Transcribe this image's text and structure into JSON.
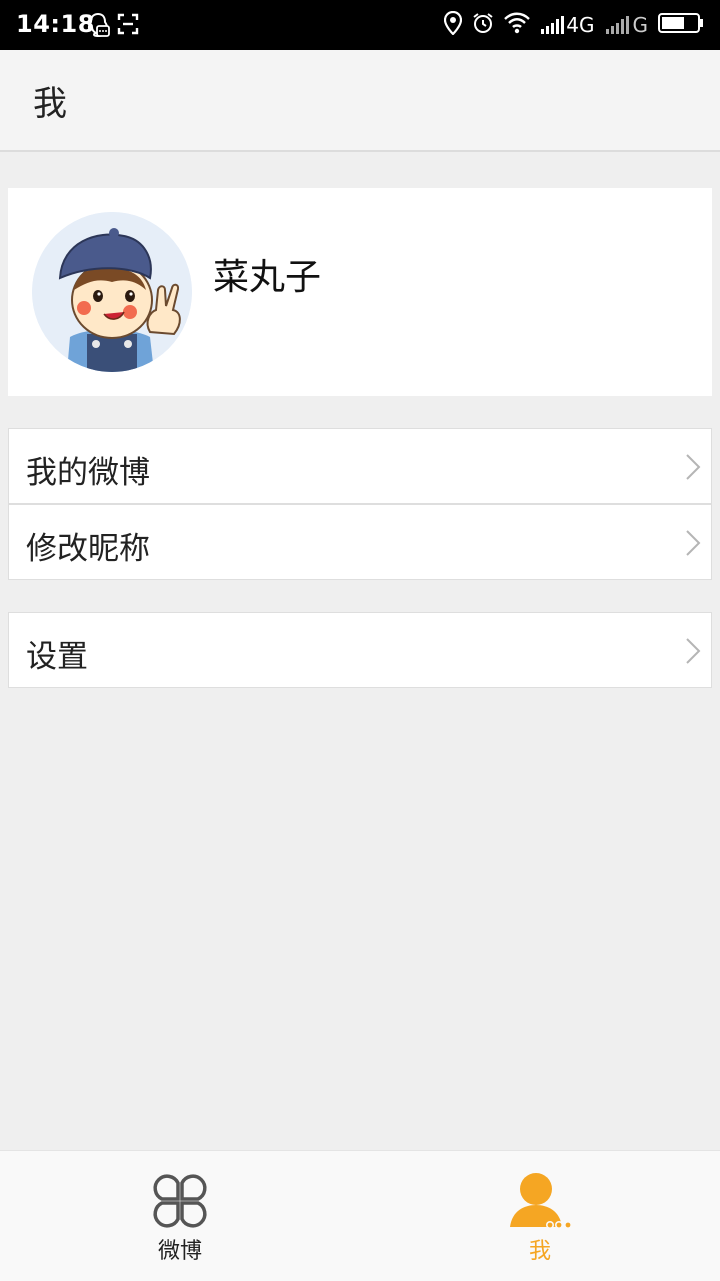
{
  "status_bar": {
    "time": "14:18",
    "network_1": "4G",
    "network_2": "G",
    "icons": [
      "qq-icon",
      "screenshot-icon",
      "location-icon",
      "alarm-icon",
      "wifi-icon",
      "signal-icon",
      "battery-icon"
    ]
  },
  "header": {
    "title": "我"
  },
  "profile": {
    "username": "菜丸子",
    "avatar": "avatar-image"
  },
  "menu_groups": [
    {
      "items": [
        {
          "label": "我的微博"
        },
        {
          "label": "修改昵称"
        }
      ]
    },
    {
      "items": [
        {
          "label": "设置"
        }
      ]
    }
  ],
  "tabbar": {
    "tabs": [
      {
        "label": "微博",
        "icon": "clover-icon",
        "active": false
      },
      {
        "label": "我",
        "icon": "profile-icon",
        "active": true
      }
    ],
    "active_color": "#f5a623",
    "inactive_color": "#222222"
  }
}
